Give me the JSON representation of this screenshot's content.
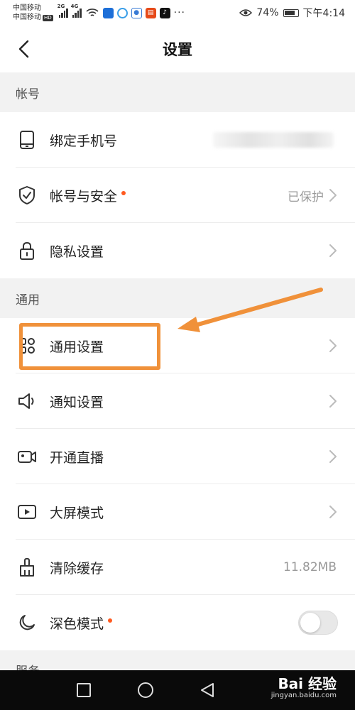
{
  "status_bar": {
    "carrier_1": "中国移动",
    "carrier_2": "中国移动",
    "hd_badge": "HD",
    "signal_gen_1": "2G",
    "signal_gen_2": "4G",
    "battery_percent": "74%",
    "time": "下午4:14"
  },
  "header": {
    "title": "设置"
  },
  "sections": {
    "account": {
      "title": "帐号",
      "rows": [
        {
          "label": "绑定手机号",
          "icon": "phone-icon",
          "value": ""
        },
        {
          "label": "帐号与安全",
          "icon": "shield-icon",
          "value": "已保护",
          "red_dot": true
        },
        {
          "label": "隐私设置",
          "icon": "lock-icon",
          "value": ""
        }
      ]
    },
    "general": {
      "title": "通用",
      "rows": [
        {
          "label": "通用设置",
          "icon": "grid-icon"
        },
        {
          "label": "通知设置",
          "icon": "speaker-icon"
        },
        {
          "label": "开通直播",
          "icon": "video-camera-icon"
        },
        {
          "label": "大屏模式",
          "icon": "play-icon"
        },
        {
          "label": "清除缓存",
          "icon": "broom-icon",
          "value": "11.82MB"
        },
        {
          "label": "深色模式",
          "icon": "moon-icon",
          "red_dot": true,
          "toggle_on": false
        }
      ]
    },
    "service": {
      "title": "服务"
    }
  },
  "watermark": {
    "brand": "Bai 经验",
    "url": "jingyan.baidu.com"
  },
  "colors": {
    "annotation": "#f0913a",
    "red_dot": "#ff5a1f",
    "section_bg": "#f2f2f2"
  }
}
